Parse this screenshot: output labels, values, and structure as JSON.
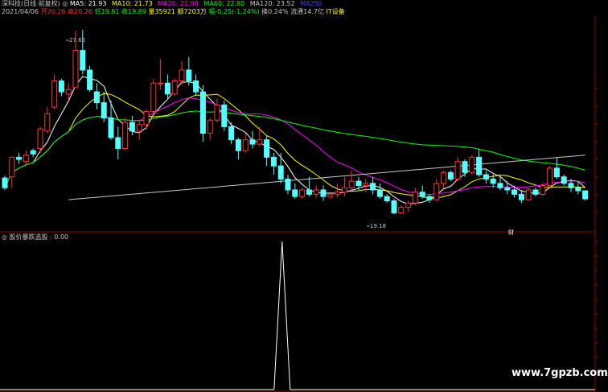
{
  "header": {
    "stock_title": "深科技(日线 前复权)",
    "ma5": "MA5: 21.93",
    "ma10": "MA10: 21.73",
    "ma20": "MA20: 21.98",
    "ma60": "MA60: 22.80",
    "ma120": "MA120: 23.52",
    "ma250": "MA250",
    "date": "2021/04/06",
    "open": "开20.26",
    "high": "高20.26",
    "low": "低19.81",
    "close": "收19.89",
    "volume": "量35921",
    "amount": "额7203万",
    "change": "幅-0.25(-1.24%)",
    "turnover": "换0.24%",
    "float_cap": "流通14.7亿",
    "sector": "IT设备"
  },
  "annotations": {
    "high_label": "27.65",
    "low_label": "19.18",
    "marker_label": "财"
  },
  "indicator": {
    "title": "股价暴跌选股 : 0.00"
  },
  "watermark": "www.7gpzb.com",
  "colors": {
    "up": "#ff3232",
    "down": "#54ffff",
    "ma5": "#ffffff",
    "ma10": "#ffff00",
    "ma20": "#ff00ff",
    "ma60": "#00ff00",
    "ma120": "#c8c8c8",
    "grid": "#8b0000",
    "background": "#000000"
  },
  "candles": [
    [
      20.85,
      20.95,
      20.3,
      20.4
    ],
    [
      20.9,
      21.8,
      20.4,
      21.8
    ],
    [
      21.8,
      22.0,
      21.5,
      21.7
    ],
    [
      21.6,
      22.1,
      21.4,
      21.9
    ],
    [
      22.1,
      22.2,
      21.8,
      21.95
    ],
    [
      22.2,
      23.2,
      22.0,
      23.1
    ],
    [
      23.0,
      24.1,
      22.9,
      23.8
    ],
    [
      24.1,
      25.6,
      24.0,
      25.3
    ],
    [
      25.3,
      25.4,
      24.6,
      24.8
    ],
    [
      24.7,
      25.2,
      24.4,
      24.9
    ],
    [
      25.0,
      27.6,
      25.0,
      26.7
    ],
    [
      26.7,
      27.65,
      25.6,
      25.8
    ],
    [
      25.8,
      26.0,
      24.8,
      24.9
    ],
    [
      24.8,
      25.2,
      24.0,
      24.3
    ],
    [
      24.3,
      24.8,
      23.4,
      23.6
    ],
    [
      23.6,
      24.4,
      22.6,
      22.7
    ],
    [
      22.7,
      23.2,
      21.7,
      22.2
    ],
    [
      22.2,
      23.6,
      22.1,
      23.4
    ],
    [
      23.4,
      23.7,
      22.8,
      23.0
    ],
    [
      23.0,
      23.5,
      22.6,
      23.3
    ],
    [
      23.3,
      24.0,
      23.1,
      23.9
    ],
    [
      23.9,
      25.4,
      23.8,
      25.2
    ],
    [
      25.2,
      26.3,
      24.9,
      25.2
    ],
    [
      25.2,
      25.6,
      24.5,
      24.7
    ],
    [
      24.7,
      25.4,
      24.6,
      25.3
    ],
    [
      25.3,
      26.2,
      25.1,
      25.8
    ],
    [
      25.8,
      26.4,
      25.1,
      25.3
    ],
    [
      25.3,
      25.6,
      24.6,
      24.8
    ],
    [
      24.8,
      25.1,
      22.5,
      22.9
    ],
    [
      22.9,
      23.6,
      22.6,
      23.5
    ],
    [
      23.5,
      24.5,
      23.4,
      24.2
    ],
    [
      24.2,
      24.4,
      23.0,
      23.2
    ],
    [
      23.2,
      23.4,
      22.4,
      22.6
    ],
    [
      22.6,
      22.7,
      21.7,
      22.1
    ],
    [
      22.1,
      22.9,
      22.0,
      22.6
    ],
    [
      22.6,
      23.0,
      22.2,
      22.4
    ],
    [
      22.4,
      23.2,
      22.3,
      22.6
    ],
    [
      22.6,
      22.8,
      21.4,
      21.8
    ],
    [
      21.8,
      22.0,
      21.0,
      21.4
    ],
    [
      21.4,
      22.0,
      20.6,
      20.8
    ],
    [
      20.8,
      21.0,
      20.1,
      20.3
    ],
    [
      20.3,
      20.6,
      19.9,
      20.0
    ],
    [
      20.0,
      20.4,
      19.9,
      20.3
    ],
    [
      20.3,
      20.9,
      20.0,
      20.1
    ],
    [
      20.1,
      20.5,
      19.95,
      20.3
    ],
    [
      20.3,
      20.5,
      19.8,
      20.0
    ],
    [
      20.0,
      20.2,
      19.9,
      20.1
    ],
    [
      20.1,
      20.6,
      19.95,
      20.2
    ],
    [
      20.2,
      20.9,
      20.0,
      20.4
    ],
    [
      20.4,
      21.2,
      20.2,
      20.7
    ],
    [
      20.7,
      20.9,
      20.3,
      20.5
    ],
    [
      20.5,
      20.8,
      20.2,
      20.6
    ],
    [
      20.6,
      20.9,
      20.1,
      20.3
    ],
    [
      20.3,
      20.6,
      19.9,
      20.0
    ],
    [
      20.0,
      20.1,
      19.7,
      19.8
    ],
    [
      19.8,
      19.9,
      19.18,
      19.25
    ],
    [
      19.25,
      19.6,
      19.18,
      19.5
    ],
    [
      19.5,
      19.8,
      19.3,
      19.7
    ],
    [
      19.7,
      20.4,
      19.6,
      20.2
    ],
    [
      20.2,
      20.5,
      19.9,
      20.0
    ],
    [
      20.0,
      20.1,
      19.7,
      19.85
    ],
    [
      19.85,
      20.8,
      19.8,
      20.6
    ],
    [
      20.6,
      21.2,
      20.4,
      21.1
    ],
    [
      21.1,
      21.2,
      20.7,
      20.8
    ],
    [
      20.8,
      21.8,
      20.7,
      21.6
    ],
    [
      21.6,
      21.7,
      20.9,
      21.1
    ],
    [
      21.1,
      21.9,
      21.0,
      21.8
    ],
    [
      21.8,
      22.2,
      20.9,
      21.0
    ],
    [
      21.0,
      21.2,
      20.6,
      20.8
    ],
    [
      20.8,
      21.0,
      20.4,
      20.6
    ],
    [
      20.6,
      20.9,
      20.3,
      20.4
    ],
    [
      20.4,
      20.7,
      20.1,
      20.3
    ],
    [
      20.3,
      20.5,
      19.95,
      20.1
    ],
    [
      20.1,
      20.3,
      19.7,
      19.85
    ],
    [
      19.85,
      20.4,
      19.8,
      20.3
    ],
    [
      20.3,
      20.4,
      20.0,
      20.1
    ],
    [
      20.1,
      20.6,
      20.0,
      20.5
    ],
    [
      20.5,
      21.4,
      20.4,
      21.3
    ],
    [
      21.3,
      21.8,
      20.8,
      20.9
    ],
    [
      20.9,
      21.0,
      20.5,
      20.6
    ],
    [
      20.6,
      20.8,
      20.2,
      20.4
    ],
    [
      20.4,
      20.7,
      20.1,
      20.26
    ],
    [
      20.26,
      20.26,
      19.81,
      19.89
    ]
  ],
  "indicator_series": {
    "spike_index": 41,
    "spike_value": 1.0
  }
}
